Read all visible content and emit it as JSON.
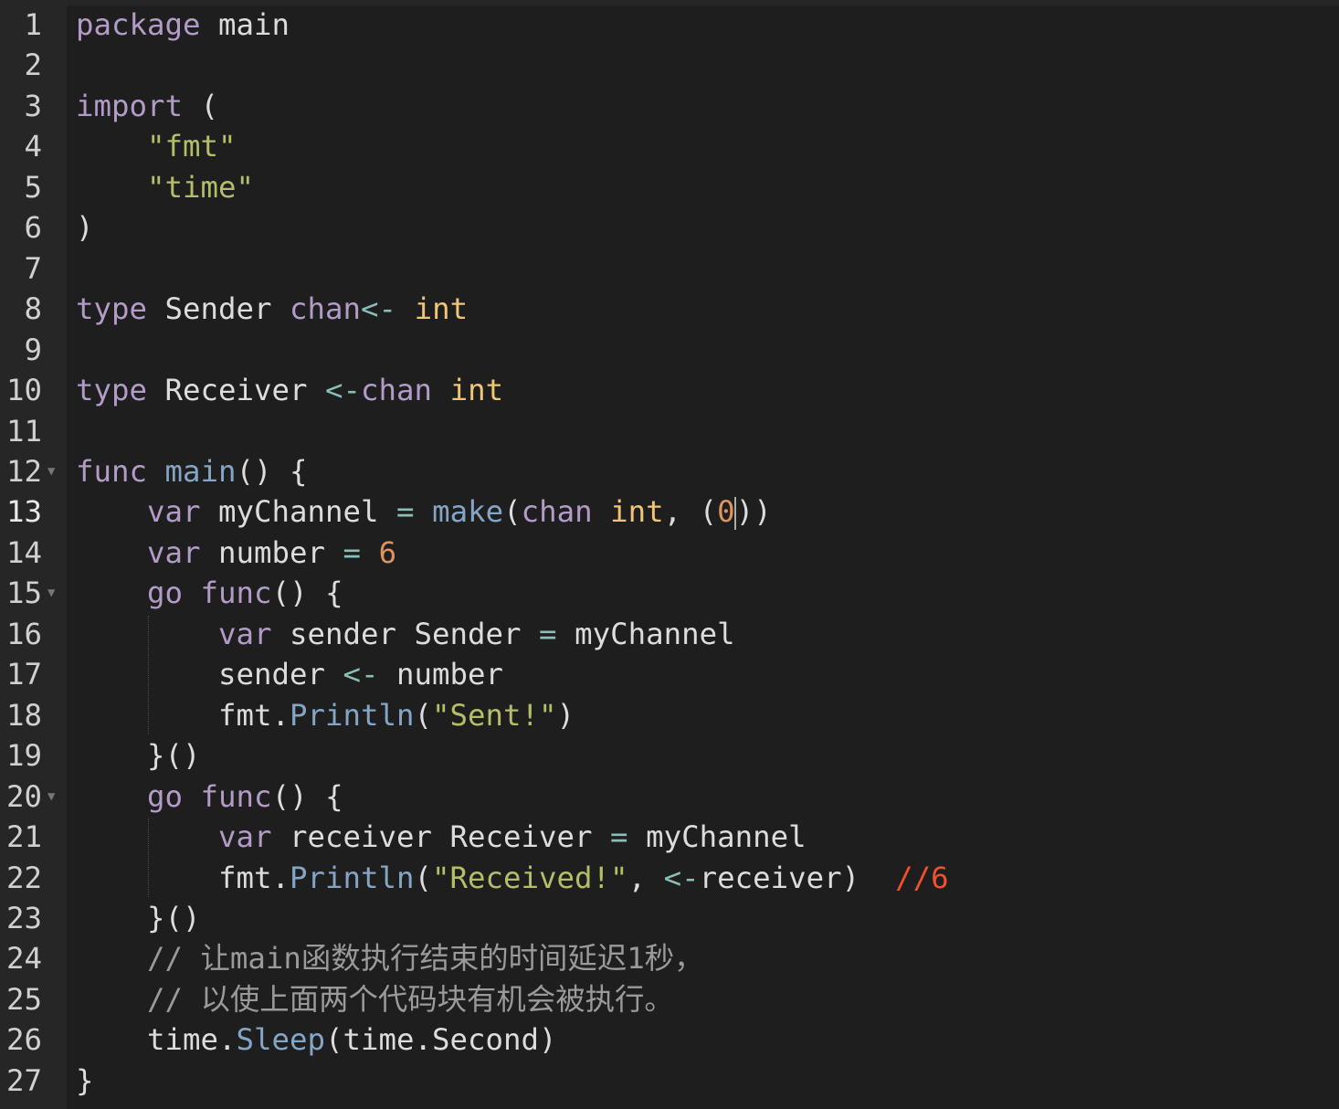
{
  "editor": {
    "colors": {
      "background": "#1e1e1e",
      "gutter": "#262626",
      "keyword": "#b39bc8",
      "function": "#85a5c7",
      "type": "#f0c674",
      "string": "#b5bd68",
      "number": "#de935f",
      "operator": "#8abeb7",
      "comment": "#9a9a9a",
      "annotation": "#f0502c"
    },
    "cursor_line": 13,
    "fold_lines": [
      12,
      15,
      20
    ],
    "lines": [
      {
        "n": "1",
        "tokens": [
          [
            "package",
            "kw"
          ],
          [
            " main",
            "pl"
          ]
        ]
      },
      {
        "n": "2",
        "tokens": []
      },
      {
        "n": "3",
        "tokens": [
          [
            "import",
            "kw"
          ],
          [
            " (",
            "pl"
          ]
        ]
      },
      {
        "n": "4",
        "tokens": [
          [
            "    ",
            "pl"
          ],
          [
            "\"fmt\"",
            "str"
          ]
        ]
      },
      {
        "n": "5",
        "tokens": [
          [
            "    ",
            "pl"
          ],
          [
            "\"time\"",
            "str"
          ]
        ]
      },
      {
        "n": "6",
        "tokens": [
          [
            ")",
            "pl"
          ]
        ]
      },
      {
        "n": "7",
        "tokens": []
      },
      {
        "n": "8",
        "tokens": [
          [
            "type",
            "kw"
          ],
          [
            " Sender ",
            "pl"
          ],
          [
            "chan",
            "kw"
          ],
          [
            "<-",
            "op"
          ],
          [
            " ",
            "pl"
          ],
          [
            "int",
            "ty"
          ]
        ]
      },
      {
        "n": "9",
        "tokens": []
      },
      {
        "n": "10",
        "tokens": [
          [
            "type",
            "kw"
          ],
          [
            " Receiver ",
            "pl"
          ],
          [
            "<-",
            "op"
          ],
          [
            "chan",
            "kw"
          ],
          [
            " ",
            "pl"
          ],
          [
            "int",
            "ty"
          ]
        ]
      },
      {
        "n": "11",
        "tokens": []
      },
      {
        "n": "12",
        "tokens": [
          [
            "func",
            "kw"
          ],
          [
            " ",
            "pl"
          ],
          [
            "main",
            "fn"
          ],
          [
            "() {",
            "pl"
          ]
        ]
      },
      {
        "n": "13",
        "tokens": [
          [
            "    ",
            "pl"
          ],
          [
            "var",
            "kw"
          ],
          [
            " myChannel ",
            "pl"
          ],
          [
            "=",
            "op"
          ],
          [
            " ",
            "pl"
          ],
          [
            "make",
            "fn"
          ],
          [
            "(",
            "pl"
          ],
          [
            "chan",
            "kw"
          ],
          [
            " ",
            "pl"
          ],
          [
            "int",
            "ty"
          ],
          [
            ", (",
            "pl"
          ],
          [
            "0",
            "num"
          ],
          [
            "|",
            "caret"
          ],
          [
            "))",
            "pl"
          ]
        ]
      },
      {
        "n": "14",
        "tokens": [
          [
            "    ",
            "pl"
          ],
          [
            "var",
            "kw"
          ],
          [
            " number ",
            "pl"
          ],
          [
            "=",
            "op"
          ],
          [
            " ",
            "pl"
          ],
          [
            "6",
            "num"
          ]
        ]
      },
      {
        "n": "15",
        "tokens": [
          [
            "    ",
            "pl"
          ],
          [
            "go",
            "kw"
          ],
          [
            " ",
            "pl"
          ],
          [
            "func",
            "kw"
          ],
          [
            "() {",
            "pl"
          ]
        ]
      },
      {
        "n": "16",
        "tokens": [
          [
            "        ",
            "pl"
          ],
          [
            "var",
            "kw"
          ],
          [
            " sender Sender ",
            "pl"
          ],
          [
            "=",
            "op"
          ],
          [
            " myChannel",
            "pl"
          ]
        ]
      },
      {
        "n": "17",
        "tokens": [
          [
            "        sender ",
            "pl"
          ],
          [
            "<-",
            "op"
          ],
          [
            " number",
            "pl"
          ]
        ]
      },
      {
        "n": "18",
        "tokens": [
          [
            "        fmt.",
            "pl"
          ],
          [
            "Println",
            "fn"
          ],
          [
            "(",
            "pl"
          ],
          [
            "\"Sent!\"",
            "str"
          ],
          [
            ")",
            "pl"
          ]
        ]
      },
      {
        "n": "19",
        "tokens": [
          [
            "    }()",
            "pl"
          ]
        ]
      },
      {
        "n": "20",
        "tokens": [
          [
            "    ",
            "pl"
          ],
          [
            "go",
            "kw"
          ],
          [
            " ",
            "pl"
          ],
          [
            "func",
            "kw"
          ],
          [
            "() {",
            "pl"
          ]
        ]
      },
      {
        "n": "21",
        "tokens": [
          [
            "        ",
            "pl"
          ],
          [
            "var",
            "kw"
          ],
          [
            " receiver Receiver ",
            "pl"
          ],
          [
            "=",
            "op"
          ],
          [
            " myChannel",
            "pl"
          ]
        ]
      },
      {
        "n": "22",
        "tokens": [
          [
            "        fmt.",
            "pl"
          ],
          [
            "Println",
            "fn"
          ],
          [
            "(",
            "pl"
          ],
          [
            "\"Received!\"",
            "str"
          ],
          [
            ", ",
            "pl"
          ],
          [
            "<-",
            "op"
          ],
          [
            "receiver)  ",
            "pl"
          ],
          [
            "//6",
            "red"
          ]
        ]
      },
      {
        "n": "23",
        "tokens": [
          [
            "    }()",
            "pl"
          ]
        ]
      },
      {
        "n": "24",
        "tokens": [
          [
            "    ",
            "pl"
          ],
          [
            "// 让main函数执行结束的时间延迟1秒，",
            "com"
          ]
        ]
      },
      {
        "n": "25",
        "tokens": [
          [
            "    ",
            "pl"
          ],
          [
            "// 以使上面两个代码块有机会被执行。",
            "com"
          ]
        ]
      },
      {
        "n": "26",
        "tokens": [
          [
            "    time.",
            "pl"
          ],
          [
            "Sleep",
            "fn"
          ],
          [
            "(time.Second)",
            "pl"
          ]
        ]
      },
      {
        "n": "27",
        "tokens": [
          [
            "}",
            "pl"
          ]
        ]
      }
    ]
  }
}
